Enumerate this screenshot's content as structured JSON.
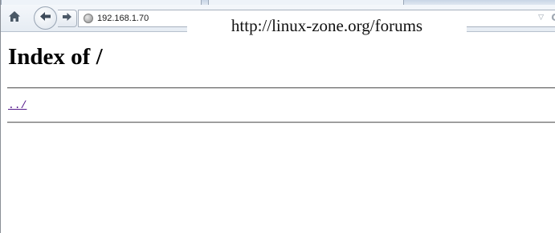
{
  "browser": {
    "address_bar": {
      "url": "192.168.1.70"
    },
    "icons": {
      "home": "home-icon",
      "back": "back-arrow-icon",
      "forward": "forward-arrow-icon",
      "site": "globe-icon",
      "dropdown": "dropdown-triangle-icon",
      "reload": "reload-icon"
    }
  },
  "watermark": {
    "text": "http://linux-zone.org/forums"
  },
  "page": {
    "title": "Index of /",
    "links": [
      {
        "label": "../"
      }
    ]
  },
  "colors": {
    "visited_link": "#551a8b",
    "chrome_background": "#e6ecf3"
  }
}
